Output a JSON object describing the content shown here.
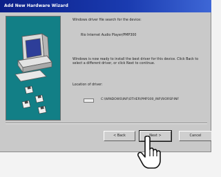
{
  "window": {
    "title": "Add New Hardware Wizard"
  },
  "content": {
    "intro": "Windows driver file search for the device:",
    "device_name": "Rio Internet Audio Player/PMP300",
    "ready_text": "Windows is now ready to install the best driver for this device. Click Back to select a different driver, or click Next to continue.",
    "location_label": "Location of driver:",
    "driver_path": "C:\\WINDOWS\\INF\\OTHER\\PMP300_INF\\RIORSP.INF"
  },
  "buttons": {
    "back_label": "< Back",
    "next_label": "Next >",
    "cancel_label": "Cancel"
  },
  "colors": {
    "title_bar": "#1a3bb0",
    "illustration_bg": "#127f86",
    "dialog_bg": "#c9c9c9"
  },
  "icons": {
    "illustration": "computer-with-floppy-disks",
    "driver": "driver-file-icon",
    "cursor": "hand-pointer-cursor"
  }
}
